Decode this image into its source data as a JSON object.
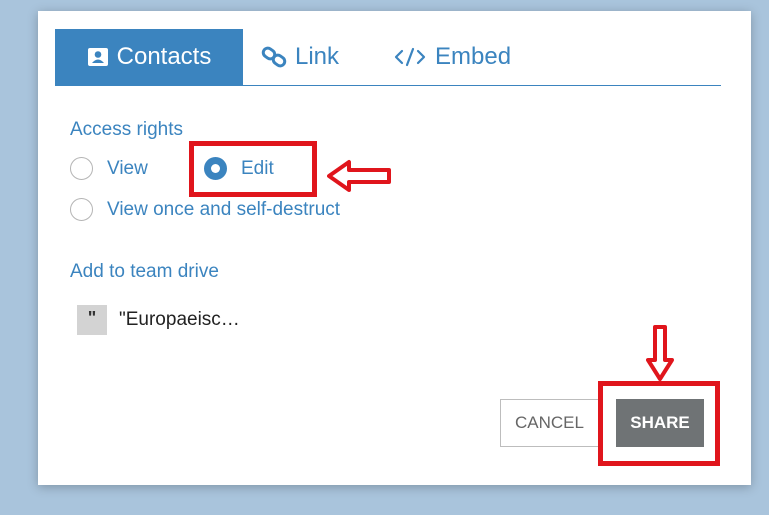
{
  "tabs": [
    {
      "label": "Contacts",
      "icon": "contact-card-icon",
      "active": true
    },
    {
      "label": "Link",
      "icon": "link-icon",
      "active": false
    },
    {
      "label": "Embed",
      "icon": "code-icon",
      "active": false
    }
  ],
  "access_rights": {
    "title": "Access rights",
    "options": [
      {
        "label": "View",
        "checked": false
      },
      {
        "label": "Edit",
        "checked": true
      },
      {
        "label": "View once and self-destruct",
        "checked": false
      }
    ]
  },
  "team_drive": {
    "title": "Add to team drive",
    "icon_glyph": "\"",
    "item": "\"Europaeisc…"
  },
  "buttons": {
    "cancel": "CANCEL",
    "share": "SHARE"
  },
  "colors": {
    "accent": "#3b84bf",
    "annotation_red": "#e0151c",
    "share_bg": "#6f7375",
    "backdrop": "#a9c4dc"
  }
}
